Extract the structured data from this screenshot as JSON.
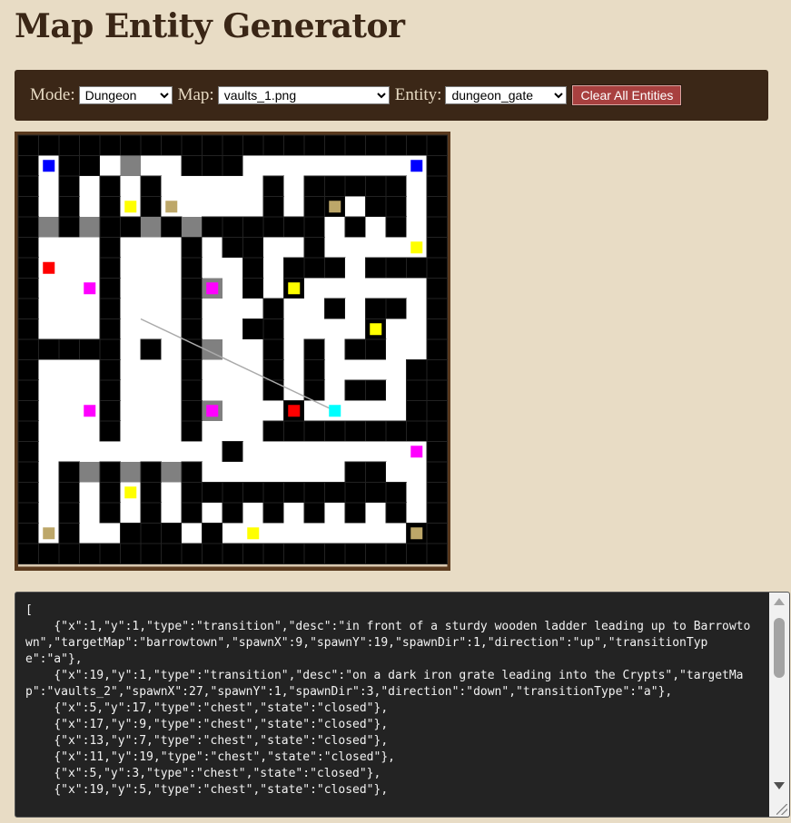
{
  "page": {
    "title": "Map Entity Generator"
  },
  "toolbar": {
    "mode_label": "Mode:",
    "mode_value": "Dungeon",
    "map_label": "Map:",
    "map_value": "vaults_1.png",
    "entity_label": "Entity:",
    "entity_value": "dungeon_gate",
    "clear_label": "Clear All Entities"
  },
  "colors": {
    "wall": "#000000",
    "wall_grid": "#222222",
    "floor": "#ffffff",
    "door": "#808080",
    "transition": "#0000ff",
    "chest": "#ffff00",
    "item": "#bda769",
    "enemy": "#ff0000",
    "npc": "#ff00ff",
    "gate": "#00ffff"
  },
  "map": {
    "cols": 21,
    "rows": 21,
    "grid": [
      "#####################",
      "#.##.D..###.........#",
      "#.#.#.#.....#.#####.#",
      "#.#.#.#.....#.##.##.#",
      "#D#D##D#D######.#.#.#",
      "#...#...#.##..#.....#",
      "#...#...#..#.###.####",
      "#...#...#D.#.#......#",
      "#...#...#...#..#.##.#",
      "#...#...#..##....#..#",
      "#####.#.#D..#.#.##..#",
      "#...#...#...#.#....##",
      "#...#...#...#.#.##.##",
      "#...#...#D...#.....##",
      "#...#...#...#########",
      "#.........#.........#",
      "#.#D#D#D#.......##..#",
      "#.#.#.#.###########.#",
      "#.#.#.#.#.#.#.#.#.#.#",
      "#.#..###.#.........##",
      "#####################"
    ],
    "entities": [
      {
        "x": 1,
        "y": 1,
        "type": "transition"
      },
      {
        "x": 19,
        "y": 1,
        "type": "transition"
      },
      {
        "x": 5,
        "y": 3,
        "type": "chest"
      },
      {
        "x": 7,
        "y": 3,
        "type": "item"
      },
      {
        "x": 15,
        "y": 3,
        "type": "item"
      },
      {
        "x": 19,
        "y": 5,
        "type": "chest"
      },
      {
        "x": 1,
        "y": 6,
        "type": "enemy"
      },
      {
        "x": 3,
        "y": 7,
        "type": "npc"
      },
      {
        "x": 9,
        "y": 7,
        "type": "npc"
      },
      {
        "x": 13,
        "y": 7,
        "type": "chest"
      },
      {
        "x": 17,
        "y": 9,
        "type": "chest"
      },
      {
        "x": 3,
        "y": 13,
        "type": "npc"
      },
      {
        "x": 9,
        "y": 13,
        "type": "npc"
      },
      {
        "x": 13,
        "y": 13,
        "type": "enemy"
      },
      {
        "x": 15,
        "y": 13,
        "type": "gate"
      },
      {
        "x": 19,
        "y": 15,
        "type": "npc"
      },
      {
        "x": 5,
        "y": 17,
        "type": "chest"
      },
      {
        "x": 1,
        "y": 19,
        "type": "item"
      },
      {
        "x": 11,
        "y": 19,
        "type": "chest"
      },
      {
        "x": 19,
        "y": 19,
        "type": "item"
      }
    ],
    "link_line": {
      "from": [
        6,
        9
      ],
      "to": [
        15,
        13
      ]
    }
  },
  "output": {
    "text": "[\n    {\"x\":1,\"y\":1,\"type\":\"transition\",\"desc\":\"in front of a sturdy wooden ladder leading up to Barrowtown\",\"targetMap\":\"barrowtown\",\"spawnX\":9,\"spawnY\":19,\"spawnDir\":1,\"direction\":\"up\",\"transitionType\":\"a\"},\n    {\"x\":19,\"y\":1,\"type\":\"transition\",\"desc\":\"on a dark iron grate leading into the Crypts\",\"targetMap\":\"vaults_2\",\"spawnX\":27,\"spawnY\":1,\"spawnDir\":3,\"direction\":\"down\",\"transitionType\":\"a\"},\n    {\"x\":5,\"y\":17,\"type\":\"chest\",\"state\":\"closed\"},\n    {\"x\":17,\"y\":9,\"type\":\"chest\",\"state\":\"closed\"},\n    {\"x\":13,\"y\":7,\"type\":\"chest\",\"state\":\"closed\"},\n    {\"x\":11,\"y\":19,\"type\":\"chest\",\"state\":\"closed\"},\n    {\"x\":5,\"y\":3,\"type\":\"chest\",\"state\":\"closed\"},\n    {\"x\":19,\"y\":5,\"type\":\"chest\",\"state\":\"closed\"},"
  }
}
